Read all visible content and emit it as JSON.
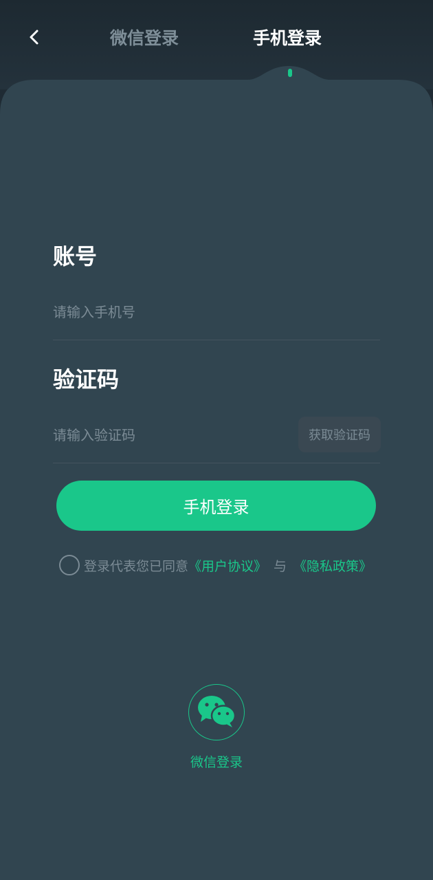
{
  "header": {
    "back_icon": "chevron-left-icon",
    "tabs": [
      {
        "label": "微信登录",
        "active": false
      },
      {
        "label": "手机登录",
        "active": true
      }
    ]
  },
  "form": {
    "account_label": "账号",
    "phone_placeholder": "请输入手机号",
    "phone_value": "",
    "code_label": "验证码",
    "code_placeholder": "请输入验证码",
    "code_value": "",
    "get_code_label": "获取验证码",
    "login_label": "手机登录"
  },
  "agreement": {
    "checked": false,
    "prefix": "登录代表您已同意",
    "user_agreement": "《用户协议》",
    "and": "与",
    "privacy_policy": "《隐私政策》"
  },
  "alt_login": {
    "icon": "wechat-icon",
    "label": "微信登录"
  },
  "colors": {
    "accent": "#1ac78a",
    "card": "#314550",
    "background": "#1f2b34",
    "muted_text": "#7b8b95"
  }
}
